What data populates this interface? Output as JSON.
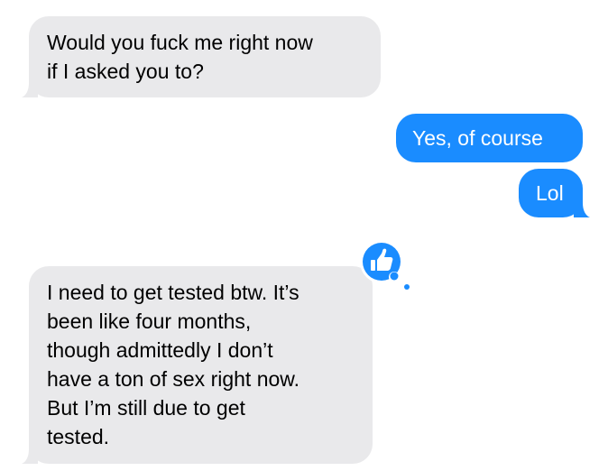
{
  "messages": [
    {
      "direction": "received",
      "text": "Would you fuck me right now\nif I asked you to?"
    },
    {
      "direction": "sent",
      "text": "Yes, of course"
    },
    {
      "direction": "sent",
      "text": "Lol"
    },
    {
      "direction": "received",
      "text": "I need to get tested btw. It’s\nbeen like four months,\nthough admittedly I don’t\nhave a ton of sex right now.\nBut I’m still due to get\ntested.",
      "reaction": "thumbs-up-icon"
    }
  ],
  "colors": {
    "received_bubble": "#e9e9eb",
    "sent_bubble": "#1a8cff",
    "tapback": "#1a8cff",
    "background": "#ffffff"
  }
}
